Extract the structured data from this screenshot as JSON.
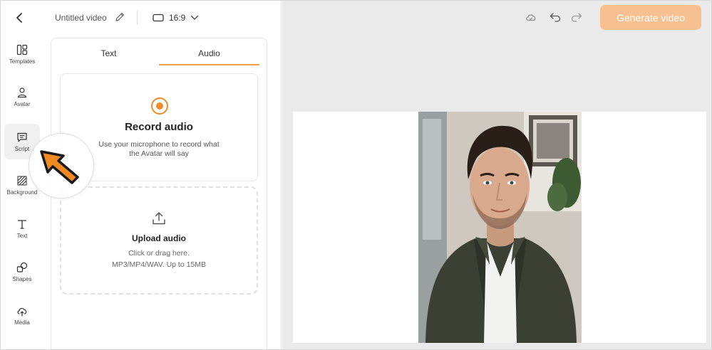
{
  "header": {
    "title": "Untitled video",
    "aspect_ratio": "16:9"
  },
  "rail": [
    {
      "label": "Templates",
      "icon": "templates-icon"
    },
    {
      "label": "Avatar",
      "icon": "avatar-icon"
    },
    {
      "label": "Script",
      "icon": "script-icon",
      "active": true
    },
    {
      "label": "Background",
      "icon": "background-icon"
    },
    {
      "label": "Text",
      "icon": "text-icon"
    },
    {
      "label": "Shapes",
      "icon": "shapes-icon"
    },
    {
      "label": "Media",
      "icon": "media-icon"
    }
  ],
  "panel": {
    "tabs": [
      {
        "label": "Text",
        "active": false
      },
      {
        "label": "Audio",
        "active": true
      }
    ],
    "record": {
      "title": "Record audio",
      "description": "Use your microphone to record what the Avatar will say"
    },
    "upload": {
      "title": "Upload audio",
      "line1": "Click or drag here.",
      "line2": "MP3/MP4/WAV. Up to 15MB"
    }
  },
  "toolbar": {
    "generate_label": "Generate video"
  },
  "colors": {
    "accent": "#f08a2a",
    "generate_button": "#f6c090",
    "canvas_bg": "#eaeaea"
  }
}
